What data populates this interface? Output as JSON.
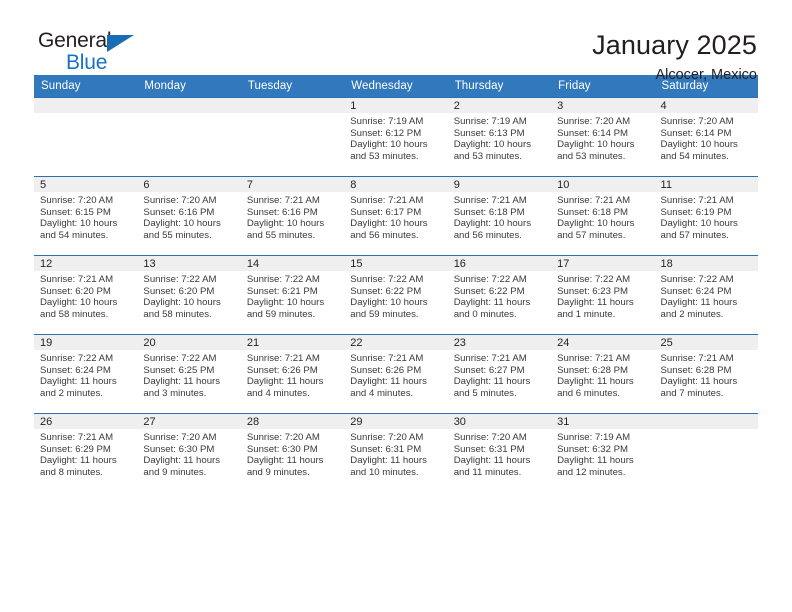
{
  "brand": {
    "name_part1": "General",
    "name_part2": "Blue",
    "triangle_icon": "triangle-logo-icon",
    "accent_color": "#1a72c4"
  },
  "header": {
    "month_title": "January 2025",
    "location": "Alcocer, Mexico"
  },
  "calendar": {
    "header_bg": "#3278bc",
    "daynum_band_bg": "#efefef",
    "weekdays": [
      "Sunday",
      "Monday",
      "Tuesday",
      "Wednesday",
      "Thursday",
      "Friday",
      "Saturday"
    ],
    "weeks": [
      [
        {
          "day": "",
          "lines": []
        },
        {
          "day": "",
          "lines": []
        },
        {
          "day": "",
          "lines": []
        },
        {
          "day": "1",
          "lines": [
            "Sunrise: 7:19 AM",
            "Sunset: 6:12 PM",
            "Daylight: 10 hours",
            "and 53 minutes."
          ]
        },
        {
          "day": "2",
          "lines": [
            "Sunrise: 7:19 AM",
            "Sunset: 6:13 PM",
            "Daylight: 10 hours",
            "and 53 minutes."
          ]
        },
        {
          "day": "3",
          "lines": [
            "Sunrise: 7:20 AM",
            "Sunset: 6:14 PM",
            "Daylight: 10 hours",
            "and 53 minutes."
          ]
        },
        {
          "day": "4",
          "lines": [
            "Sunrise: 7:20 AM",
            "Sunset: 6:14 PM",
            "Daylight: 10 hours",
            "and 54 minutes."
          ]
        }
      ],
      [
        {
          "day": "5",
          "lines": [
            "Sunrise: 7:20 AM",
            "Sunset: 6:15 PM",
            "Daylight: 10 hours",
            "and 54 minutes."
          ]
        },
        {
          "day": "6",
          "lines": [
            "Sunrise: 7:20 AM",
            "Sunset: 6:16 PM",
            "Daylight: 10 hours",
            "and 55 minutes."
          ]
        },
        {
          "day": "7",
          "lines": [
            "Sunrise: 7:21 AM",
            "Sunset: 6:16 PM",
            "Daylight: 10 hours",
            "and 55 minutes."
          ]
        },
        {
          "day": "8",
          "lines": [
            "Sunrise: 7:21 AM",
            "Sunset: 6:17 PM",
            "Daylight: 10 hours",
            "and 56 minutes."
          ]
        },
        {
          "day": "9",
          "lines": [
            "Sunrise: 7:21 AM",
            "Sunset: 6:18 PM",
            "Daylight: 10 hours",
            "and 56 minutes."
          ]
        },
        {
          "day": "10",
          "lines": [
            "Sunrise: 7:21 AM",
            "Sunset: 6:18 PM",
            "Daylight: 10 hours",
            "and 57 minutes."
          ]
        },
        {
          "day": "11",
          "lines": [
            "Sunrise: 7:21 AM",
            "Sunset: 6:19 PM",
            "Daylight: 10 hours",
            "and 57 minutes."
          ]
        }
      ],
      [
        {
          "day": "12",
          "lines": [
            "Sunrise: 7:21 AM",
            "Sunset: 6:20 PM",
            "Daylight: 10 hours",
            "and 58 minutes."
          ]
        },
        {
          "day": "13",
          "lines": [
            "Sunrise: 7:22 AM",
            "Sunset: 6:20 PM",
            "Daylight: 10 hours",
            "and 58 minutes."
          ]
        },
        {
          "day": "14",
          "lines": [
            "Sunrise: 7:22 AM",
            "Sunset: 6:21 PM",
            "Daylight: 10 hours",
            "and 59 minutes."
          ]
        },
        {
          "day": "15",
          "lines": [
            "Sunrise: 7:22 AM",
            "Sunset: 6:22 PM",
            "Daylight: 10 hours",
            "and 59 minutes."
          ]
        },
        {
          "day": "16",
          "lines": [
            "Sunrise: 7:22 AM",
            "Sunset: 6:22 PM",
            "Daylight: 11 hours",
            "and 0 minutes."
          ]
        },
        {
          "day": "17",
          "lines": [
            "Sunrise: 7:22 AM",
            "Sunset: 6:23 PM",
            "Daylight: 11 hours",
            "and 1 minute."
          ]
        },
        {
          "day": "18",
          "lines": [
            "Sunrise: 7:22 AM",
            "Sunset: 6:24 PM",
            "Daylight: 11 hours",
            "and 2 minutes."
          ]
        }
      ],
      [
        {
          "day": "19",
          "lines": [
            "Sunrise: 7:22 AM",
            "Sunset: 6:24 PM",
            "Daylight: 11 hours",
            "and 2 minutes."
          ]
        },
        {
          "day": "20",
          "lines": [
            "Sunrise: 7:22 AM",
            "Sunset: 6:25 PM",
            "Daylight: 11 hours",
            "and 3 minutes."
          ]
        },
        {
          "day": "21",
          "lines": [
            "Sunrise: 7:21 AM",
            "Sunset: 6:26 PM",
            "Daylight: 11 hours",
            "and 4 minutes."
          ]
        },
        {
          "day": "22",
          "lines": [
            "Sunrise: 7:21 AM",
            "Sunset: 6:26 PM",
            "Daylight: 11 hours",
            "and 4 minutes."
          ]
        },
        {
          "day": "23",
          "lines": [
            "Sunrise: 7:21 AM",
            "Sunset: 6:27 PM",
            "Daylight: 11 hours",
            "and 5 minutes."
          ]
        },
        {
          "day": "24",
          "lines": [
            "Sunrise: 7:21 AM",
            "Sunset: 6:28 PM",
            "Daylight: 11 hours",
            "and 6 minutes."
          ]
        },
        {
          "day": "25",
          "lines": [
            "Sunrise: 7:21 AM",
            "Sunset: 6:28 PM",
            "Daylight: 11 hours",
            "and 7 minutes."
          ]
        }
      ],
      [
        {
          "day": "26",
          "lines": [
            "Sunrise: 7:21 AM",
            "Sunset: 6:29 PM",
            "Daylight: 11 hours",
            "and 8 minutes."
          ]
        },
        {
          "day": "27",
          "lines": [
            "Sunrise: 7:20 AM",
            "Sunset: 6:30 PM",
            "Daylight: 11 hours",
            "and 9 minutes."
          ]
        },
        {
          "day": "28",
          "lines": [
            "Sunrise: 7:20 AM",
            "Sunset: 6:30 PM",
            "Daylight: 11 hours",
            "and 9 minutes."
          ]
        },
        {
          "day": "29",
          "lines": [
            "Sunrise: 7:20 AM",
            "Sunset: 6:31 PM",
            "Daylight: 11 hours",
            "and 10 minutes."
          ]
        },
        {
          "day": "30",
          "lines": [
            "Sunrise: 7:20 AM",
            "Sunset: 6:31 PM",
            "Daylight: 11 hours",
            "and 11 minutes."
          ]
        },
        {
          "day": "31",
          "lines": [
            "Sunrise: 7:19 AM",
            "Sunset: 6:32 PM",
            "Daylight: 11 hours",
            "and 12 minutes."
          ]
        },
        {
          "day": "",
          "lines": []
        }
      ]
    ]
  }
}
